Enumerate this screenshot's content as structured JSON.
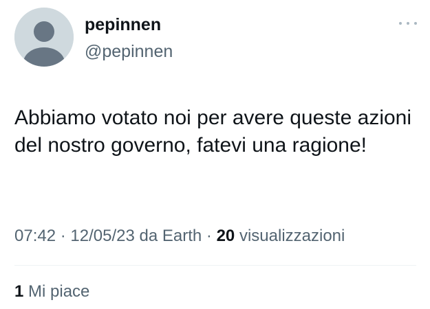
{
  "author": {
    "display_name": "pepinnen",
    "handle": "@pepinnen",
    "avatar_icon": "default-avatar-icon"
  },
  "more_icon": "more-horizontal-icon",
  "tweet": {
    "text": "Abbiamo votato noi per avere queste azioni del nostro governo, fatevi una ragione!"
  },
  "meta": {
    "time": "07:42",
    "separator": "·",
    "date": "12/05/23",
    "source": "da Earth",
    "views_count": "20",
    "views_label": "visualizzazioni"
  },
  "engagement": {
    "likes_count": "1",
    "likes_label": "Mi piace"
  },
  "colors": {
    "primary_text": "#0f1419",
    "secondary_text": "#536471",
    "avatar_bg": "#cfd9de",
    "avatar_fg": "#687684",
    "divider": "#eff3f4"
  }
}
